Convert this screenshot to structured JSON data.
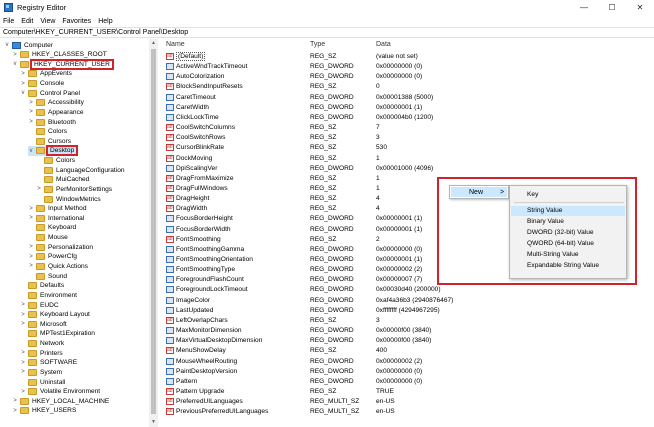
{
  "window": {
    "title": "Registry Editor",
    "minimize": "—",
    "maximize": "☐",
    "close": "✕"
  },
  "menu": [
    "File",
    "Edit",
    "View",
    "Favorites",
    "Help"
  ],
  "address": "Computer\\HKEY_CURRENT_USER\\Control Panel\\Desktop",
  "tree": [
    {
      "label": "Computer",
      "exp": "v",
      "icon": "pc"
    },
    {
      "label": "HKEY_CLASSES_ROOT",
      "exp": ">",
      "icon": "folder"
    },
    {
      "label": "HKEY_CURRENT_USER",
      "exp": "v",
      "icon": "folder",
      "hl": true
    },
    {
      "label": "AppEvents",
      "exp": ">",
      "icon": "folder"
    },
    {
      "label": "Console",
      "exp": ">",
      "icon": "folder"
    },
    {
      "label": "Control Panel",
      "exp": "v",
      "icon": "folder"
    },
    {
      "label": "Accessibility",
      "exp": ">",
      "icon": "folder"
    },
    {
      "label": "Appearance",
      "exp": ">",
      "icon": "folder"
    },
    {
      "label": "Bluetooth",
      "exp": ">",
      "icon": "folder"
    },
    {
      "label": "Colors",
      "exp": "",
      "icon": "folder"
    },
    {
      "label": "Cursors",
      "exp": "",
      "icon": "folder"
    },
    {
      "label": "Desktop",
      "exp": "v",
      "icon": "folder",
      "hl": true,
      "sel": true
    },
    {
      "label": "Colors",
      "exp": "",
      "icon": "folder"
    },
    {
      "label": "LanguageConfiguration",
      "exp": "",
      "icon": "folder"
    },
    {
      "label": "MuiCached",
      "exp": "",
      "icon": "folder"
    },
    {
      "label": "PerMonitorSettings",
      "exp": ">",
      "icon": "folder"
    },
    {
      "label": "WindowMetrics",
      "exp": "",
      "icon": "folder"
    },
    {
      "label": "Input Method",
      "exp": ">",
      "icon": "folder"
    },
    {
      "label": "International",
      "exp": ">",
      "icon": "folder"
    },
    {
      "label": "Keyboard",
      "exp": "",
      "icon": "folder"
    },
    {
      "label": "Mouse",
      "exp": "",
      "icon": "folder"
    },
    {
      "label": "Personalization",
      "exp": ">",
      "icon": "folder"
    },
    {
      "label": "PowerCfg",
      "exp": ">",
      "icon": "folder"
    },
    {
      "label": "Quick Actions",
      "exp": ">",
      "icon": "folder"
    },
    {
      "label": "Sound",
      "exp": "",
      "icon": "folder"
    },
    {
      "label": "Defaults",
      "exp": "",
      "icon": "folder"
    },
    {
      "label": "Environment",
      "exp": "",
      "icon": "folder"
    },
    {
      "label": "EUDC",
      "exp": ">",
      "icon": "folder"
    },
    {
      "label": "Keyboard Layout",
      "exp": ">",
      "icon": "folder"
    },
    {
      "label": "Microsoft",
      "exp": ">",
      "icon": "folder"
    },
    {
      "label": "MPTest1Expiration",
      "exp": "",
      "icon": "folder"
    },
    {
      "label": "Network",
      "exp": "",
      "icon": "folder"
    },
    {
      "label": "Printers",
      "exp": ">",
      "icon": "folder"
    },
    {
      "label": "SOFTWARE",
      "exp": ">",
      "icon": "folder"
    },
    {
      "label": "System",
      "exp": ">",
      "icon": "folder"
    },
    {
      "label": "Uninstall",
      "exp": "",
      "icon": "folder"
    },
    {
      "label": "Volatile Environment",
      "exp": ">",
      "icon": "folder"
    },
    {
      "label": "HKEY_LOCAL_MACHINE",
      "exp": ">",
      "icon": "folder"
    },
    {
      "label": "HKEY_USERS",
      "exp": ">",
      "icon": "folder"
    }
  ],
  "columns": {
    "name": "Name",
    "type": "Type",
    "data": "Data"
  },
  "values": [
    {
      "name": "(Default)",
      "type": "REG_SZ",
      "data": "(value not set)",
      "icon": "sz"
    },
    {
      "name": "ActiveWndTrackTimeout",
      "type": "REG_DWORD",
      "data": "0x00000000 (0)",
      "icon": "dw"
    },
    {
      "name": "AutoColorization",
      "type": "REG_DWORD",
      "data": "0x00000000 (0)",
      "icon": "dw"
    },
    {
      "name": "BlockSendInputResets",
      "type": "REG_SZ",
      "data": "0",
      "icon": "sz"
    },
    {
      "name": "CaretTimeout",
      "type": "REG_DWORD",
      "data": "0x00001388 (5000)",
      "icon": "dw"
    },
    {
      "name": "CaretWidth",
      "type": "REG_DWORD",
      "data": "0x00000001 (1)",
      "icon": "dw"
    },
    {
      "name": "ClickLockTime",
      "type": "REG_DWORD",
      "data": "0x000004b0 (1200)",
      "icon": "dw"
    },
    {
      "name": "CoolSwitchColumns",
      "type": "REG_SZ",
      "data": "7",
      "icon": "sz"
    },
    {
      "name": "CoolSwitchRows",
      "type": "REG_SZ",
      "data": "3",
      "icon": "sz"
    },
    {
      "name": "CursorBlinkRate",
      "type": "REG_SZ",
      "data": "530",
      "icon": "sz"
    },
    {
      "name": "DockMoving",
      "type": "REG_SZ",
      "data": "1",
      "icon": "sz"
    },
    {
      "name": "DpiScalingVer",
      "type": "REG_DWORD",
      "data": "0x00001000 (4096)",
      "icon": "dw"
    },
    {
      "name": "DragFromMaximize",
      "type": "REG_SZ",
      "data": "1",
      "icon": "sz"
    },
    {
      "name": "DragFullWindows",
      "type": "REG_SZ",
      "data": "1",
      "icon": "sz"
    },
    {
      "name": "DragHeight",
      "type": "REG_SZ",
      "data": "4",
      "icon": "sz"
    },
    {
      "name": "DragWidth",
      "type": "REG_SZ",
      "data": "4",
      "icon": "sz"
    },
    {
      "name": "FocusBorderHeight",
      "type": "REG_DWORD",
      "data": "0x00000001 (1)",
      "icon": "dw"
    },
    {
      "name": "FocusBorderWidth",
      "type": "REG_DWORD",
      "data": "0x00000001 (1)",
      "icon": "dw"
    },
    {
      "name": "FontSmoothing",
      "type": "REG_SZ",
      "data": "2",
      "icon": "sz"
    },
    {
      "name": "FontSmoothingGamma",
      "type": "REG_DWORD",
      "data": "0x00000000 (0)",
      "icon": "dw"
    },
    {
      "name": "FontSmoothingOrientation",
      "type": "REG_DWORD",
      "data": "0x00000001 (1)",
      "icon": "dw"
    },
    {
      "name": "FontSmoothingType",
      "type": "REG_DWORD",
      "data": "0x00000002 (2)",
      "icon": "dw"
    },
    {
      "name": "ForegroundFlashCount",
      "type": "REG_DWORD",
      "data": "0x00000007 (7)",
      "icon": "dw"
    },
    {
      "name": "ForegroundLockTimeout",
      "type": "REG_DWORD",
      "data": "0x00030d40 (200000)",
      "icon": "dw"
    },
    {
      "name": "ImageColor",
      "type": "REG_DWORD",
      "data": "0xaf4a36b3 (2940876467)",
      "icon": "dw"
    },
    {
      "name": "LastUpdated",
      "type": "REG_DWORD",
      "data": "0xffffffff (4294967295)",
      "icon": "dw"
    },
    {
      "name": "LeftOverlapChars",
      "type": "REG_SZ",
      "data": "3",
      "icon": "sz"
    },
    {
      "name": "MaxMonitorDimension",
      "type": "REG_DWORD",
      "data": "0x00000f00 (3840)",
      "icon": "dw"
    },
    {
      "name": "MaxVirtualDesktopDimension",
      "type": "REG_DWORD",
      "data": "0x00000f00 (3840)",
      "icon": "dw"
    },
    {
      "name": "MenuShowDelay",
      "type": "REG_SZ",
      "data": "400",
      "icon": "sz"
    },
    {
      "name": "MouseWheelRouting",
      "type": "REG_DWORD",
      "data": "0x00000002 (2)",
      "icon": "dw"
    },
    {
      "name": "PaintDesktopVersion",
      "type": "REG_DWORD",
      "data": "0x00000000 (0)",
      "icon": "dw"
    },
    {
      "name": "Pattern",
      "type": "REG_DWORD",
      "data": "0x00000000 (0)",
      "icon": "dw"
    },
    {
      "name": "Pattern Upgrade",
      "type": "REG_SZ",
      "data": "TRUE",
      "icon": "sz"
    },
    {
      "name": "PreferredUILanguages",
      "type": "REG_MULTI_SZ",
      "data": "en-US",
      "icon": "sz"
    },
    {
      "name": "PreviousPreferredUILanguages",
      "type": "REG_MULTI_SZ",
      "data": "en-US",
      "icon": "sz"
    }
  ],
  "context_menu": {
    "new_label": "New",
    "arrow": ">",
    "items": [
      "Key",
      "String Value",
      "Binary Value",
      "DWORD (32-bit) Value",
      "QWORD (64-bit) Value",
      "Multi-String Value",
      "Expandable String Value"
    ],
    "active_item": "String Value"
  },
  "colors": {
    "highlight": "#d0232b",
    "menu_hover": "#cce8ff",
    "selection": "#cce4f7"
  }
}
